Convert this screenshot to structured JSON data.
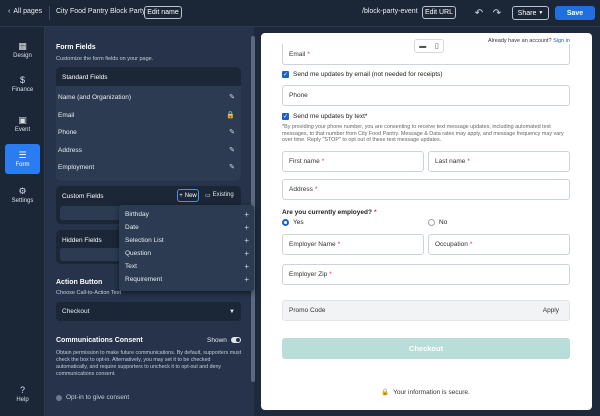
{
  "topbar": {
    "back_label": "All pages",
    "page_title": "City Food Pantry Block Party",
    "edit_name_label": "Edit name",
    "url": "/block-party-event",
    "edit_url_label": "Edit URL",
    "share_label": "Share",
    "save_label": "Save"
  },
  "nav": {
    "items": [
      {
        "label": "Design",
        "icon": "brush-icon"
      },
      {
        "label": "Finance",
        "icon": "dollar-icon"
      },
      {
        "label": "Event",
        "icon": "calendar-icon"
      },
      {
        "label": "Form",
        "icon": "form-icon"
      },
      {
        "label": "Settings",
        "icon": "gear-icon"
      }
    ],
    "help_label": "Help"
  },
  "panel": {
    "title": "Form Fields",
    "subtitle": "Customize the form fields on your page.",
    "standard_fields_title": "Standard Fields",
    "standard_fields": [
      "Name (and Organization)",
      "Email",
      "Phone",
      "Address",
      "Employment"
    ],
    "custom_fields_title": "Custom Fields",
    "new_label": "New",
    "existing_label": "Existing",
    "hidden_fields_title": "Hidden Fields",
    "action_button_title": "Action Button",
    "action_button_sub": "Choose Call-to-Action Text",
    "action_button_value": "Checkout",
    "consent_title": "Communications Consent",
    "consent_state": "Shown",
    "consent_desc": "Obtain permission to make future communications. By default, supporters must check the box to opt-in. Alternatively, you may set it to be checked automatically, and require supporters to uncheck it to opt-out and deny communications consent.",
    "optin_label": "Opt-in to give consent"
  },
  "menu": {
    "items": [
      "Birthday",
      "Date",
      "Selection List",
      "Question",
      "Text",
      "Requirement"
    ]
  },
  "preview": {
    "have_account": "Already have an account?",
    "sign_in": "Sign in",
    "email_label": "Email",
    "email_updates": "Send me updates by email (not needed for receipts)",
    "phone_label": "Phone",
    "text_updates": "Send me updates by text*",
    "text_disclaimer": "*By providing your phone number, you are consenting to receive text message updates, including automated text messages, to that number from City Food Pantry. Message & Data rates may apply, and message frequency may vary over time. Reply \"STOP\" to opt out of these text message updates.",
    "first_name_label": "First name",
    "last_name_label": "Last name",
    "address_label": "Address",
    "employed_question": "Are you currently employed?",
    "yes_label": "Yes",
    "no_label": "No",
    "employer_name_label": "Employer Name",
    "occupation_label": "Occupation",
    "employer_zip_label": "Employer Zip",
    "promo_label": "Promo Code",
    "apply_label": "Apply",
    "checkout_label": "Checkout",
    "secure_label": "Your information is secure."
  },
  "colors": {
    "accent": "#1f6fe0",
    "checkout_disabled": "#b9ddd9",
    "panel_bg": "#26334a"
  }
}
